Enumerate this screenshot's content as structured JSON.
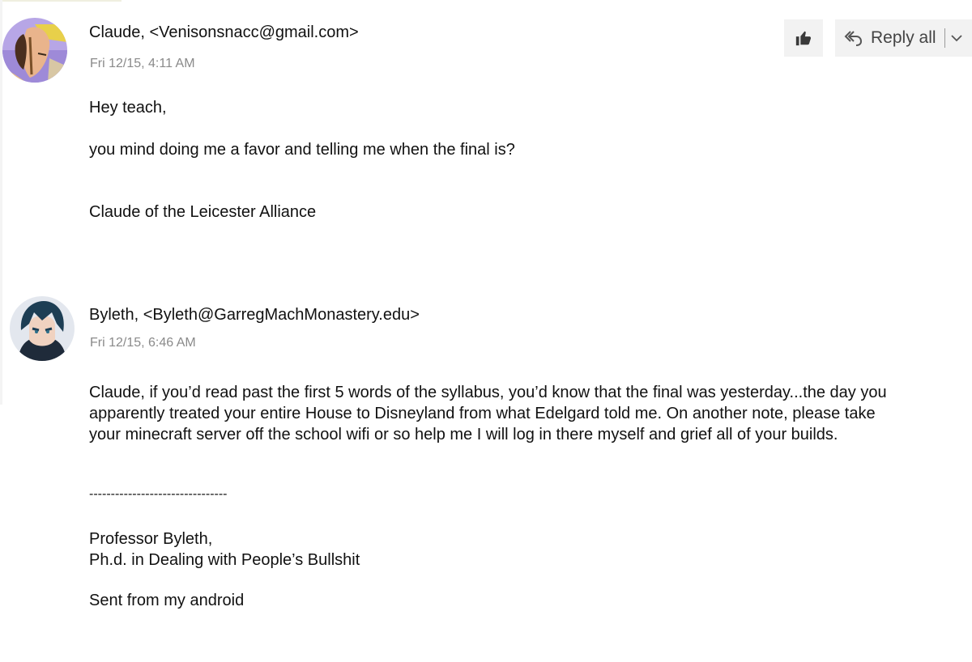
{
  "toolbar": {
    "like_icon": "thumbs-up-icon",
    "reply_icon": "reply-all-icon",
    "reply_all_label": "Reply all",
    "dropdown_icon": "chevron-down-icon"
  },
  "messages": [
    {
      "sender": "Claude, <Venisonsnacc@gmail.com>",
      "timestamp": "Fri 12/15, 4:11 AM",
      "body": {
        "greeting": "Hey teach,",
        "line1": "you mind doing me a favor and telling me when the final is?",
        "signature": "Claude of the Leicester Alliance"
      }
    },
    {
      "sender": "Byleth, <Byleth@GarregMachMonastery.edu>",
      "timestamp": "Fri 12/15, 6:46 AM",
      "body": {
        "paragraph": "Claude, if you’d read past the first 5 words of the syllabus, you’d know that the final was yesterday...the day you apparently treated your entire House to Disneyland from what Edelgard told me. On another note, please take your minecraft server off the school wifi or so help me I will log in there myself and grief all of your builds.",
        "divider": "--------------------------------",
        "sig_name": "Professor Byleth,",
        "sig_title": "Ph.d. in Dealing with People’s Bullshit",
        "sent_from": "Sent from my android"
      }
    }
  ],
  "colors": {
    "text": "#111111",
    "timestamp": "#8a8a8a",
    "button_bg": "#f2f2f2"
  }
}
